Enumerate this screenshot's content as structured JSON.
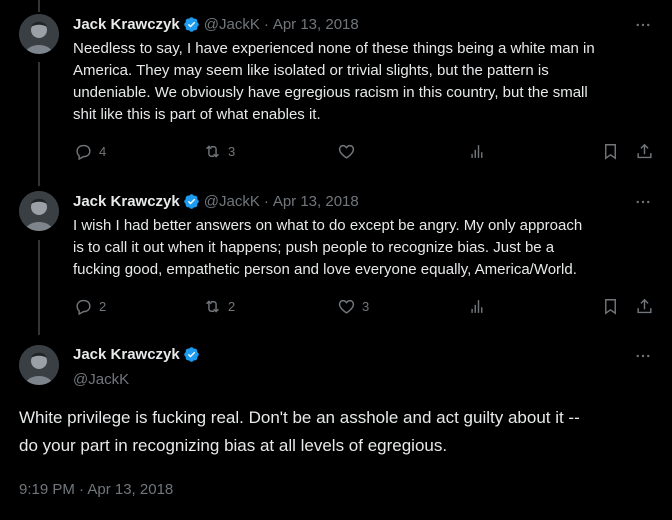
{
  "tweets": [
    {
      "name": "Jack Krawczyk",
      "handle": "@JackK",
      "separator": "·",
      "date": "Apr 13, 2018",
      "text": "Needless to say, I have experienced none of these things being a white man in\nAmerica. They may seem like isolated or trivial slights, but the pattern is\nundeniable. We obviously have egregious racism in this country, but the small\nshit like this is part of what enables it.",
      "replies": "4",
      "retweets": "3",
      "likes": "",
      "views": ""
    },
    {
      "name": "Jack Krawczyk",
      "handle": "@JackK",
      "separator": "·",
      "date": "Apr 13, 2018",
      "text": "I wish I had better answers on what to do except be angry. My only approach\nis to call it out when it happens; push people to recognize bias. Just be a\nfucking good, empathetic person and love everyone equally, America/World.",
      "replies": "2",
      "retweets": "2",
      "likes": "3",
      "views": ""
    }
  ],
  "main_tweet": {
    "name": "Jack Krawczyk",
    "handle": "@JackK",
    "text": "White privilege is fucking real. Don't be an asshole and act guilty about it --\ndo your part in recognizing bias at all levels of egregious.",
    "timestamp": "9:19 PM · Apr 13, 2018"
  },
  "icons": {
    "reply": "reply-icon",
    "retweet": "retweet-icon",
    "like": "heart-icon",
    "views": "views-icon",
    "bookmark": "bookmark-icon",
    "share": "share-icon",
    "more": "more-icon",
    "verified": "verified-badge-icon"
  },
  "colors": {
    "background": "#000000",
    "text": "#e7e9ea",
    "muted": "#71767b",
    "verified": "#1d9bf0",
    "thread_line": "#333639"
  }
}
